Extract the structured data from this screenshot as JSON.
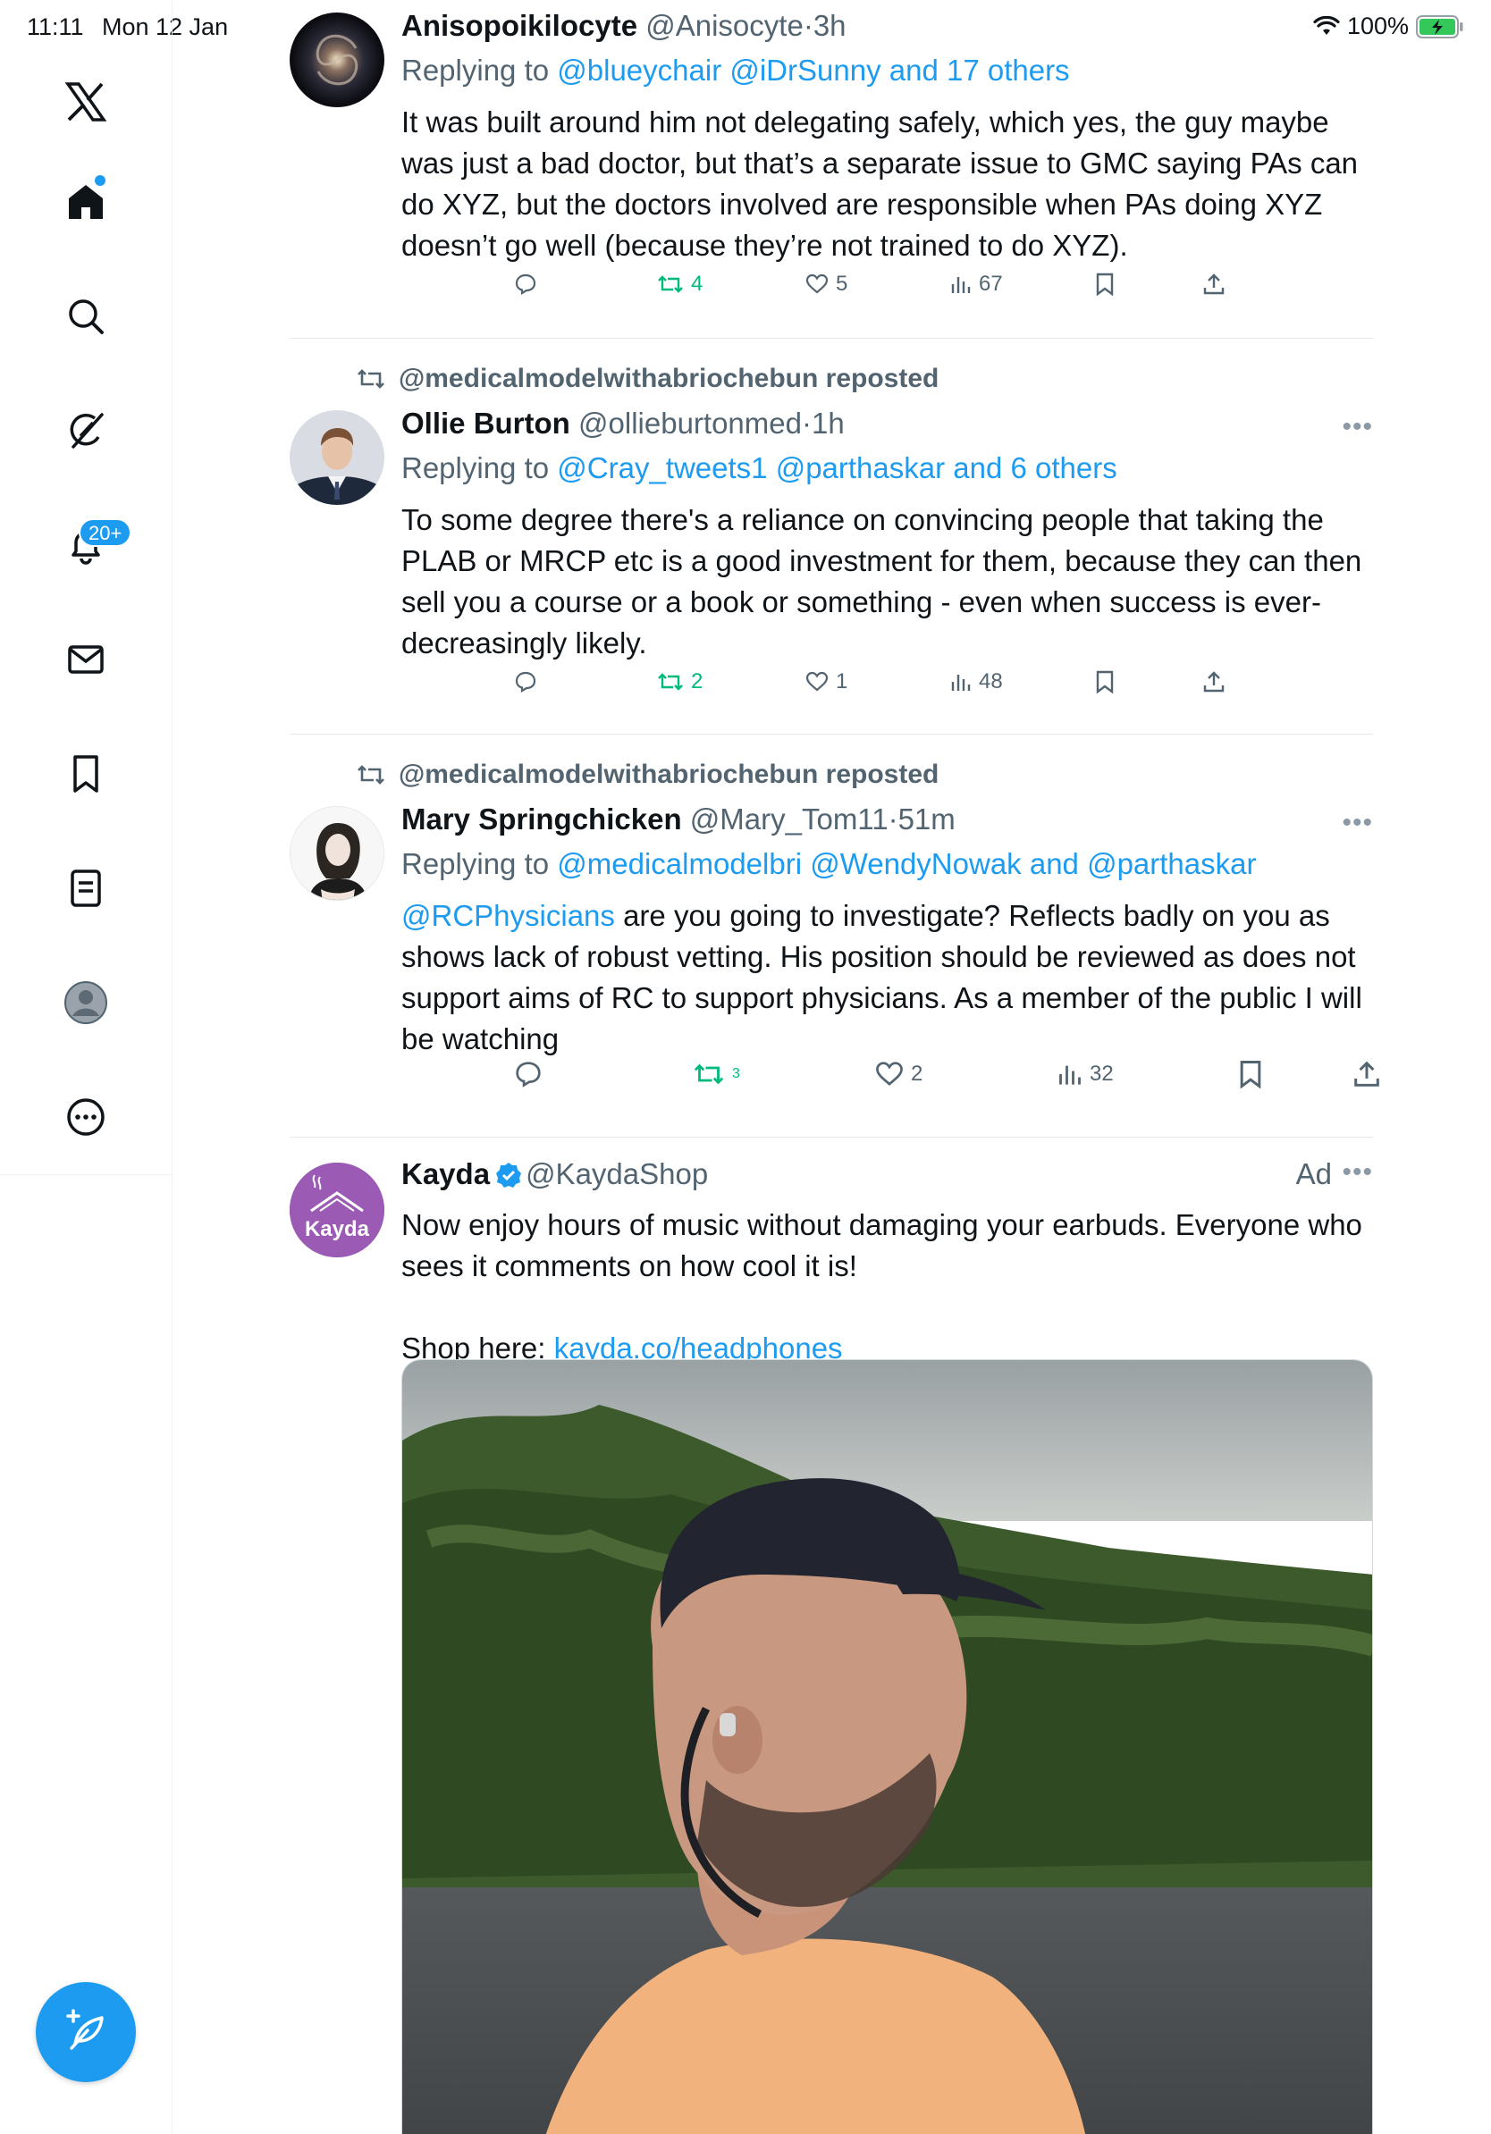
{
  "status_bar": {
    "time": "11:11",
    "date": "Mon 12 Jan",
    "battery": "100%"
  },
  "sidebar": {
    "notifications_badge": "20+",
    "items": [
      {
        "icon": "x-logo-icon"
      },
      {
        "icon": "home-icon"
      },
      {
        "icon": "search-icon"
      },
      {
        "icon": "grok-icon"
      },
      {
        "icon": "notifications-icon"
      },
      {
        "icon": "messages-icon"
      },
      {
        "icon": "bookmarks-icon"
      },
      {
        "icon": "lists-icon"
      },
      {
        "icon": "profile-icon"
      },
      {
        "icon": "more-icon"
      }
    ],
    "compose_icon": "compose-icon"
  },
  "tweets": [
    {
      "name": "Anisopoikilocyte",
      "handle": "@Anisocyte",
      "sep": "·",
      "time": "3h",
      "reply_prefix": "Replying to ",
      "reply_to": "@blueychair @iDrSunny and 17 others",
      "text": "It was built around him not delegating safely, which yes, the guy maybe was just a bad doctor, but that’s a separate issue to GMC saying PAs can do XYZ, but the doctors involved are responsible when PAs doing XYZ doesn’t go well (because they’re not trained to do XYZ).",
      "reposts": "4",
      "likes": "5",
      "views": "67"
    },
    {
      "repost_label": "@medicalmodelwithabriochebun reposted",
      "name": "Ollie Burton",
      "handle": "@ollieburtonmed",
      "sep": "·",
      "time": "1h",
      "reply_prefix": "Replying to ",
      "reply_to": "@Cray_tweets1 @parthaskar and 6 others",
      "text": "To some degree there's a reliance on convincing people that taking the PLAB or MRCP etc is a good investment for them, because they can then sell you a course or a book or something - even when success is ever-decreasingly likely.",
      "reposts": "2",
      "likes": "1",
      "views": "48"
    },
    {
      "repost_label": "@medicalmodelwithabriochebun reposted",
      "name": "Mary Springchicken",
      "handle": "@Mary_Tom11",
      "sep": "·",
      "time": "51m",
      "reply_prefix": "Replying to ",
      "reply_to": "@medicalmodelbri @WendyNowak and @parthaskar",
      "mention": "@RCPhysicians",
      "text": " are you going to investigate?  Reflects badly on you as shows lack of robust vetting. His position should be reviewed as does not support aims of RC to support physicians. As a member of the public I will be watching",
      "reposts": "3",
      "likes": "2",
      "views": "32"
    },
    {
      "name": "Kayda",
      "handle": "@KaydaShop",
      "ad_label": "Ad",
      "avatar_text": "Kayda",
      "text": "Now enjoy hours of music without damaging your earbuds. Everyone who sees it comments on how cool it is!",
      "shop_prefix": "Shop here: ",
      "shop_link": "kayda.co/headphones"
    }
  ]
}
